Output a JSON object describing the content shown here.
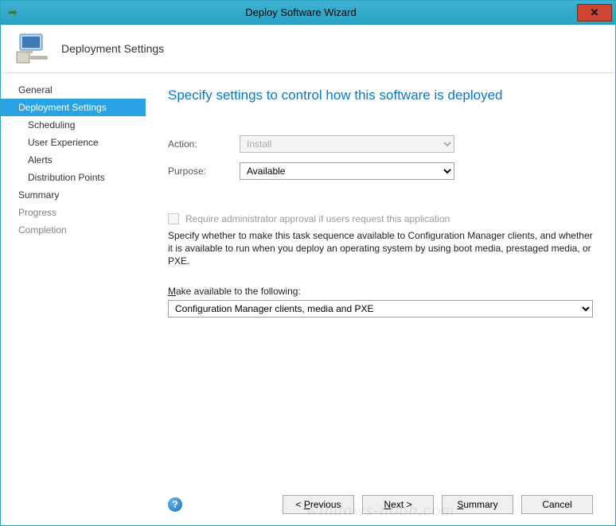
{
  "window": {
    "title": "Deploy Software Wizard"
  },
  "header": {
    "title": "Deployment Settings"
  },
  "sidebar": {
    "items": [
      {
        "label": "General",
        "type": "top"
      },
      {
        "label": "Deployment Settings",
        "type": "selected"
      },
      {
        "label": "Scheduling",
        "type": "sub"
      },
      {
        "label": "User Experience",
        "type": "sub"
      },
      {
        "label": "Alerts",
        "type": "sub"
      },
      {
        "label": "Distribution Points",
        "type": "sub"
      },
      {
        "label": "Summary",
        "type": "top"
      },
      {
        "label": "Progress",
        "type": "muted"
      },
      {
        "label": "Completion",
        "type": "muted"
      }
    ]
  },
  "page": {
    "heading": "Specify settings to control how this software is deployed",
    "action_label": "Action:",
    "action_value": "Install",
    "purpose_label": "Purpose:",
    "purpose_value": "Available",
    "checkbox_label": "Require administrator approval if users request this application",
    "description": "Specify whether to make this task sequence available to Configuration Manager clients, and whether it is available to run when you deploy an operating system by using boot media, prestaged media, or PXE.",
    "avail_label_pre": "M",
    "avail_label_post": "ake available to the following:",
    "avail_value": "Configuration Manager clients, media and PXE"
  },
  "buttons": {
    "previous": "Previous",
    "next": "Next",
    "summary": "Summary",
    "cancel": "Cancel"
  },
  "watermark": "windows-noob.com"
}
